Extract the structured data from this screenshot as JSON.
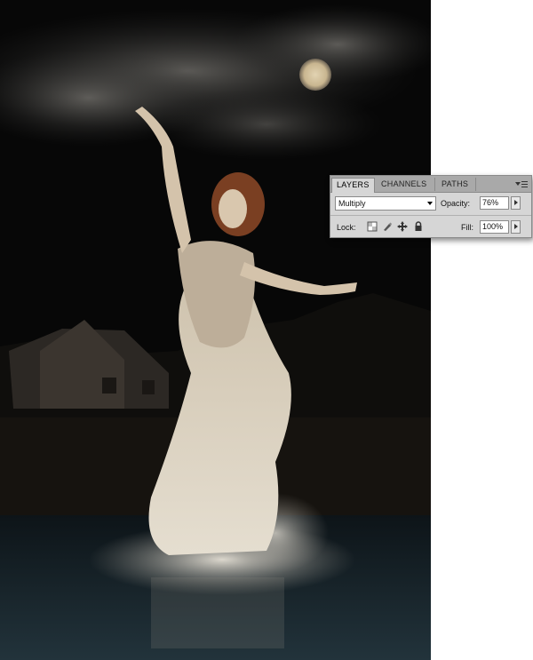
{
  "artwork": {
    "description_icon": "image-icon",
    "colors": {
      "sky": "#0a0a0a",
      "clouds": "#5b5a58",
      "moon": "#d8c7a6",
      "dress": "#cfc7b5",
      "hair": "#8a4a2a",
      "water": "#1a2a33"
    }
  },
  "panel": {
    "tabs": [
      {
        "label": "LAYERS",
        "active": true
      },
      {
        "label": "CHANNELS",
        "active": false
      },
      {
        "label": "PATHS",
        "active": false
      }
    ],
    "menu_icon": "panel-menu-icon",
    "blend_mode": {
      "value": "Multiply"
    },
    "opacity": {
      "label": "Opacity:",
      "value": "76%"
    },
    "lock": {
      "label": "Lock:",
      "icons": [
        "lock-transparent-pixels-icon",
        "lock-image-pixels-icon",
        "lock-position-icon",
        "lock-all-icon"
      ]
    },
    "fill": {
      "label": "Fill:",
      "value": "100%"
    }
  }
}
